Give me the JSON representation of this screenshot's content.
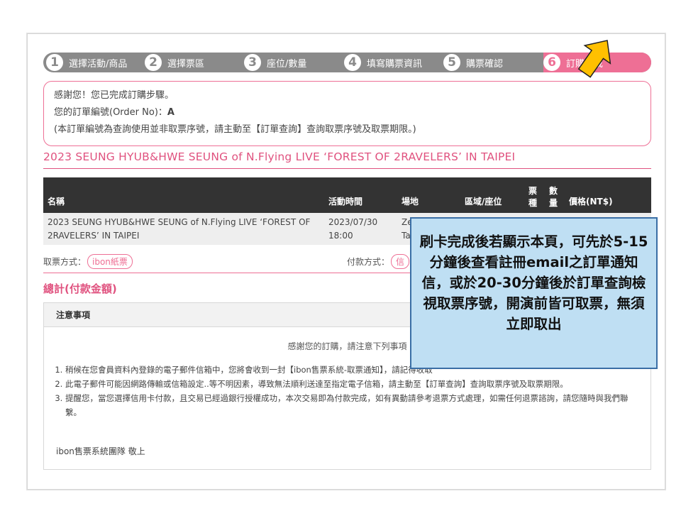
{
  "steps": [
    {
      "num": "1",
      "label": "選擇活動/商品"
    },
    {
      "num": "2",
      "label": "選擇票區"
    },
    {
      "num": "3",
      "label": "座位/數量"
    },
    {
      "num": "4",
      "label": "填寫購票資訊"
    },
    {
      "num": "5",
      "label": "購票確認"
    },
    {
      "num": "6",
      "label": "訂購完成"
    }
  ],
  "thanks": {
    "line1": "感謝您！您已完成訂購步驟。",
    "line2_label": "您的訂單編號(Order  No)：",
    "line2_value": "A",
    "line3": "(本訂單編號為查詢使用並非取票序號，請主動至【訂單查詢】查詢取票序號及取票期限。)"
  },
  "event_title": "2023 SEUNG HYUB&HWE SEUNG of N.Flying LIVE ‘FOREST OF 2RAVELERS’  IN TAIPEI",
  "table": {
    "headers": {
      "name": "名稱",
      "time": "活動時間",
      "venue": "場地",
      "area": "區域/座位",
      "type": "票種",
      "qty": "數量",
      "price": "價格(NT$)"
    },
    "row": {
      "name": "2023 SEUNG HYUB&HWE SEUNG of N.Flying LIVE ‘FOREST OF 2RAVELERS’  IN TAIPEI",
      "date": "2023/07/30",
      "time": "18:00",
      "venue_1": "Ze",
      "venue_2": "Ta"
    }
  },
  "pickup": {
    "label": "取票方式：",
    "value": "ibon紙票"
  },
  "payment": {
    "label": "付款方式：",
    "value": "信"
  },
  "total_label": "總計(付款金額)",
  "notice": {
    "header": "注意事項",
    "intro": "感謝您的訂購，請注意下列事項",
    "items": [
      "稍候在您會員資料內登錄的電子郵件信箱中，您將會收到一封【ibon售票系統-取票通知】，請記得收取",
      "此電子郵件可能因網路傳輸或信箱設定..等不明因素，導致無法順利送達至指定電子信箱，請主動至【訂單查詢】查詢取票序號及取票期限。",
      "提醒您，當您選擇信用卡付款，且交易已經過銀行授權成功，本次交易即為付款完成，如有異動請參考退票方式處理，如需任何退票諮詢，請您隨時與我們聯繫。"
    ],
    "signature": "ibon售票系統團隊  敬上"
  },
  "callout": "刷卡完成後若顯示本頁，可先於5-15分鐘後查看註冊email之訂單通知信，或於20-30分鐘後於訂單查詢檢視取票序號，開演前皆可取票，無須立即取出",
  "colors": {
    "accent": "#ee6f95",
    "step_bar": "#8a8a8a",
    "callout_bg": "#bfdff3",
    "arrow": "#ffc000"
  }
}
